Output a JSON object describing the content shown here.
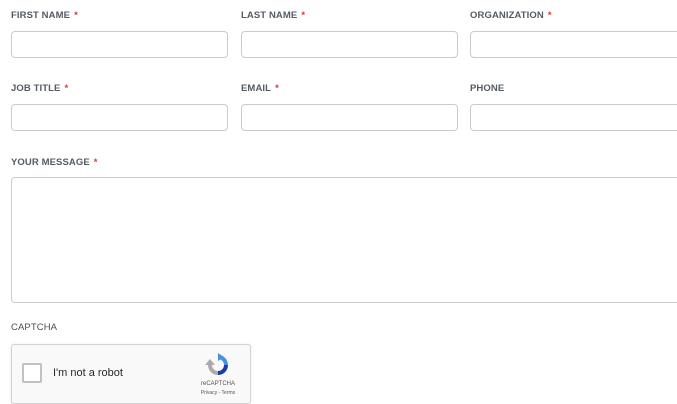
{
  "form": {
    "first_name": {
      "label": "FIRST NAME",
      "required": "*",
      "value": ""
    },
    "last_name": {
      "label": "LAST NAME",
      "required": "*",
      "value": ""
    },
    "organization": {
      "label": "ORGANIZATION",
      "required": "*",
      "value": ""
    },
    "job_title": {
      "label": "JOB TITLE",
      "required": "*",
      "value": ""
    },
    "email": {
      "label": "EMAIL",
      "required": "*",
      "value": ""
    },
    "phone": {
      "label": "PHONE",
      "value": ""
    },
    "message": {
      "label": "YOUR MESSAGE",
      "required": "*",
      "value": ""
    },
    "captcha": {
      "label": "CAPTCHA",
      "checkbox_text": "I'm not a robot",
      "brand": "reCAPTCHA",
      "terms": "Privacy - Terms",
      "checked": false
    }
  },
  "colors": {
    "required_marker": "#d43a3a",
    "label_text": "#555b63",
    "input_border": "#c8ccd0",
    "recaptcha_blue": "#4a90e2",
    "recaptcha_dark_blue": "#1c3aa9"
  }
}
